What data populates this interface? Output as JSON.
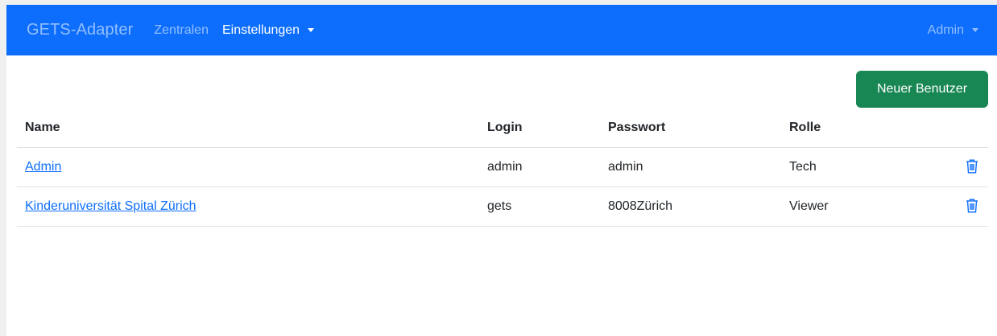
{
  "navbar": {
    "brand": "GETS-Adapter",
    "links": [
      {
        "label": "Zentralen"
      },
      {
        "label": "Einstellungen"
      }
    ],
    "user_menu": "Admin",
    "bg_color": "#0d6efd"
  },
  "actions": {
    "new_user_label": "Neuer Benutzer",
    "new_user_color": "#198754"
  },
  "table": {
    "headers": {
      "name": "Name",
      "login": "Login",
      "password": "Passwort",
      "role": "Rolle"
    },
    "rows": [
      {
        "name": "Admin",
        "login": "admin",
        "password": "admin",
        "role": "Tech",
        "action_icon": "trash-icon"
      },
      {
        "name": "Kinderuniversität Spital Zürich",
        "login": "gets",
        "password": "8008Zürich",
        "role": "Viewer",
        "action_icon": "trash-icon"
      }
    ]
  }
}
